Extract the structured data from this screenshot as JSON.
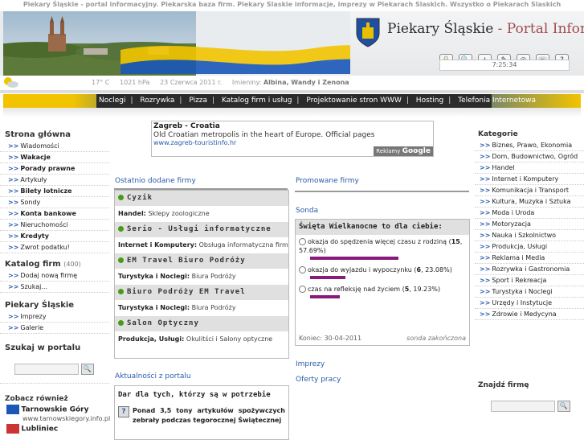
{
  "site": {
    "top_title": "Piekary Śląskie - portal informacyjny. Piekarska baza firm. Piekary Slaskie informacje, imprezy w Piekarach Slaskich. Wszystko o Piekarach Slaskich",
    "brand_name": "Piekary Śląskie",
    "brand_sub": "- Portal Informacyjny",
    "clock": "7:25:34"
  },
  "infobar": {
    "temp": "17° C",
    "pressure": "1021 hPa",
    "date": "23 Czerwca 2011 r.",
    "names_label": "Imieniny:",
    "names": "Albina, Wandy i Zenona"
  },
  "toolbar": {
    "icons": [
      "lock-icon",
      "search-icon",
      "add-icon",
      "edit-icon",
      "mail-icon",
      "phone-icon",
      "help-icon"
    ],
    "glyphs": [
      "🔒",
      "🔍",
      "+",
      "✎",
      "◎",
      "☏",
      "?"
    ]
  },
  "nav": [
    "Noclegi",
    "Rozrywka",
    "Pizza",
    "Katalog firm i usług",
    "Projektowanie stron WWW",
    "Hosting",
    "Telefonia Internetowa"
  ],
  "left": {
    "main_title": "Strona główna",
    "main_items": [
      {
        "label": "Wiadomości",
        "bold": false
      },
      {
        "label": "Wakacje",
        "bold": true
      },
      {
        "label": "Porady prawne",
        "bold": true
      },
      {
        "label": "Artykuły",
        "bold": false
      },
      {
        "label": "Bilety lotnicze",
        "bold": true
      },
      {
        "label": "Sondy",
        "bold": false
      },
      {
        "label": "Konta bankowe",
        "bold": true
      },
      {
        "label": "Nieruchomości",
        "bold": false
      },
      {
        "label": "Kredyty",
        "bold": true
      },
      {
        "label": "Zwrot podatku!",
        "bold": false
      }
    ],
    "catalog_title": "Katalog firm",
    "catalog_count": "(400)",
    "catalog_items": [
      "Dodaj nową firmę",
      "Szukaj..."
    ],
    "city_title": "Piekary Śląskie",
    "city_items": [
      "Imprezy",
      "Galerie"
    ],
    "search_title": "Szukaj w portalu",
    "see_title": "Zobacz również",
    "see_items": [
      {
        "name": "Tarnowskie Góry",
        "url": "www.tarnowskiegory.info.pl"
      },
      {
        "name": "Lubliniec",
        "url": ""
      }
    ]
  },
  "ad": {
    "title": "Zagreb - Croatia",
    "desc": "Old Croatian metropolis in the heart of Europe. Official pages",
    "url": "www.zagreb-touristinfo.hr",
    "badge_label": "Reklamy",
    "badge_brand": "Google"
  },
  "recent": {
    "title": "Ostatnio dodane firmy",
    "firms": [
      {
        "name": "Cyzik",
        "cat": "Handel:",
        "desc": "Sklepy zoologiczne"
      },
      {
        "name": "Serio - Usługi informatyczne",
        "cat": "Internet i Komputery:",
        "desc": "Obsługa informatyczna firm"
      },
      {
        "name": "EM Travel Biuro Podróży",
        "cat": "Turystyka i Noclegi:",
        "desc": "Biura Podróży"
      },
      {
        "name": "Biuro Podróży EM Travel",
        "cat": "Turystyka i Noclegi:",
        "desc": "Biura Podróży"
      },
      {
        "name": "Salon Optyczny",
        "cat": "Produkcja, Usługi:",
        "desc": "Okulitści i Salony optyczne"
      }
    ]
  },
  "promoted": {
    "title": "Promowane firmy"
  },
  "poll": {
    "section_title": "Sonda",
    "question": "Święta Wielkanocne to dla ciebie:",
    "options": [
      {
        "text": "okazja do spędzenia więcej czasu z rodziną",
        "votes": "15",
        "pct": "57.69%",
        "frac": 0.5769
      },
      {
        "text": "okazja do wyjazdu i wypoczynku",
        "votes": "6",
        "pct": "23.08%",
        "frac": 0.2308
      },
      {
        "text": "czas na refleksję nad życiem",
        "votes": "5",
        "pct": "19.23%",
        "frac": 0.1923
      }
    ],
    "end_label": "Koniec: 30-04-2011",
    "status": "sonda zakończona"
  },
  "links": {
    "events": "Imprezy",
    "jobs": "Oferty pracy"
  },
  "news": {
    "title": "Aktualności z portalu",
    "headline": "Dar dla tych, którzy są w potrzebie",
    "body": "Ponad 3,5 tony artykułów spożywczych zebrały podczas tegorocznej Świątecznej"
  },
  "right": {
    "cat_title": "Kategorie",
    "categories": [
      "Biznes, Prawo, Ekonomia",
      "Dom, Budownictwo, Ogród",
      "Handel",
      "Internet i Komputery",
      "Komunikacja i Transport",
      "Kultura, Muzyka i Sztuka",
      "Moda i Uroda",
      "Motoryzacja",
      "Nauka i Szkolnictwo",
      "Produkcja, Usługi",
      "Reklama i Media",
      "Rozrywka i Gastronomia",
      "Sport i Rekreacja",
      "Turystyka i Noclegi",
      "Urzędy i Instytucje",
      "Zdrowie i Medycyna"
    ],
    "find_title": "Znajdź firmę"
  },
  "colors": {
    "link": "#2a5caa",
    "poll_bar": "#8a1a7a",
    "brand_accent": "#a24d4d",
    "nav_yellow": "#f2c400",
    "nav_blue": "#1a57b7"
  }
}
